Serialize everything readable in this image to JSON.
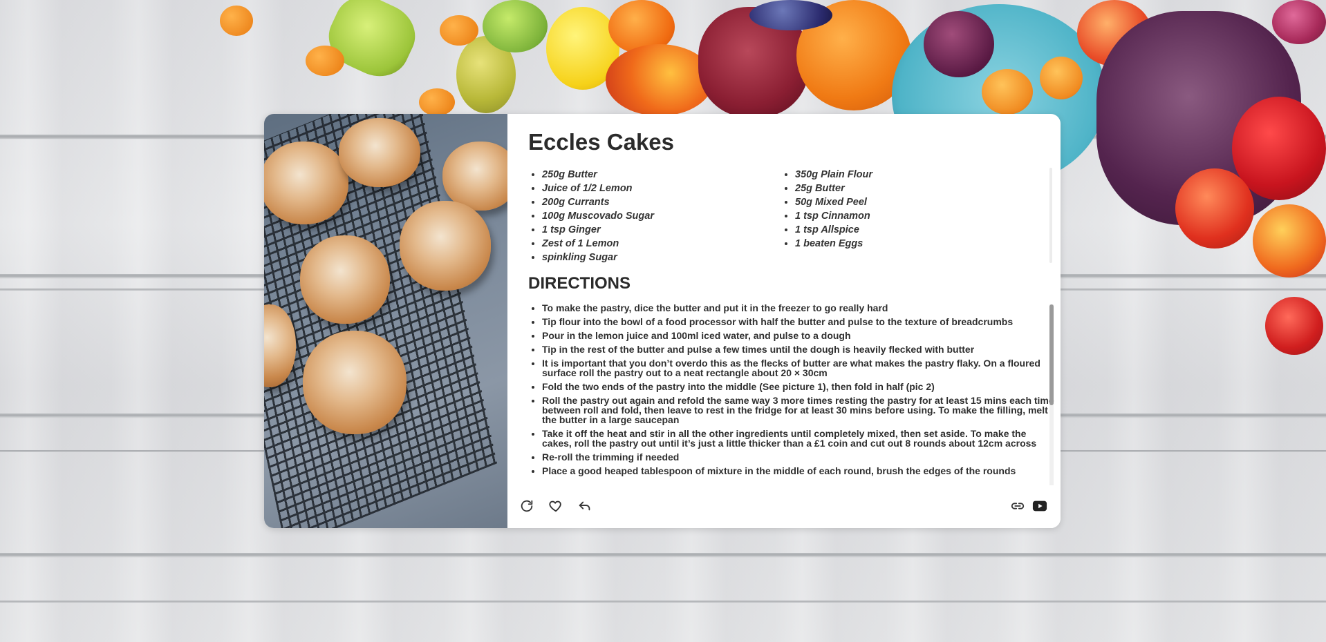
{
  "recipe": {
    "title": "Eccles Cakes",
    "ingredients_left": [
      "250g Butter",
      "Juice of 1/2 Lemon",
      "200g Currants",
      "100g Muscovado Sugar",
      "1 tsp Ginger",
      "Zest of 1 Lemon",
      "spinkling Sugar"
    ],
    "ingredients_right": [
      "350g Plain Flour",
      "25g Butter",
      "50g Mixed Peel",
      "1 tsp Cinnamon",
      "1 tsp Allspice",
      "1 beaten Eggs"
    ],
    "directions_heading": "DIRECTIONS",
    "directions": [
      "To make the pastry, dice the butter and put it in the freezer to go really hard",
      "Tip flour into the bowl of a food processor with half the butter and pulse to the texture of breadcrumbs",
      "Pour in the lemon juice and 100ml iced water, and pulse to a dough",
      "Tip in the rest of the butter and pulse a few times until the dough is heavily flecked with butter",
      "It is important that you don’t overdo this as the flecks of butter are what makes the pastry flaky. On a floured surface roll the pastry out to a neat rectangle about 20 × 30cm",
      "Fold the two ends of the pastry into the middle (See picture 1), then fold in half (pic 2)",
      "Roll the pastry out again and refold the same way 3 more times resting the pastry for at least 15 mins each time between roll and fold, then leave to rest in the fridge for at least 30 mins before using. To make the filling, melt the butter in a large saucepan",
      "Take it off the heat and stir in all the other ingredients until completely mixed, then set aside. To make the cakes, roll the pastry out until it’s just a little thicker than a £1 coin and cut out 8 rounds about 12cm across",
      "Re-roll the trimming if needed",
      "Place a good heaped tablespoon of mixture in the middle of each round, brush the edges of the rounds"
    ]
  },
  "actions": {
    "left": [
      "refresh-icon",
      "heart-icon",
      "undo-icon"
    ],
    "right": [
      "link-icon",
      "youtube-icon"
    ]
  },
  "colors": {
    "card_bg": "#ffffff",
    "text": "#2b2b2b",
    "background": "#dcdde0"
  }
}
